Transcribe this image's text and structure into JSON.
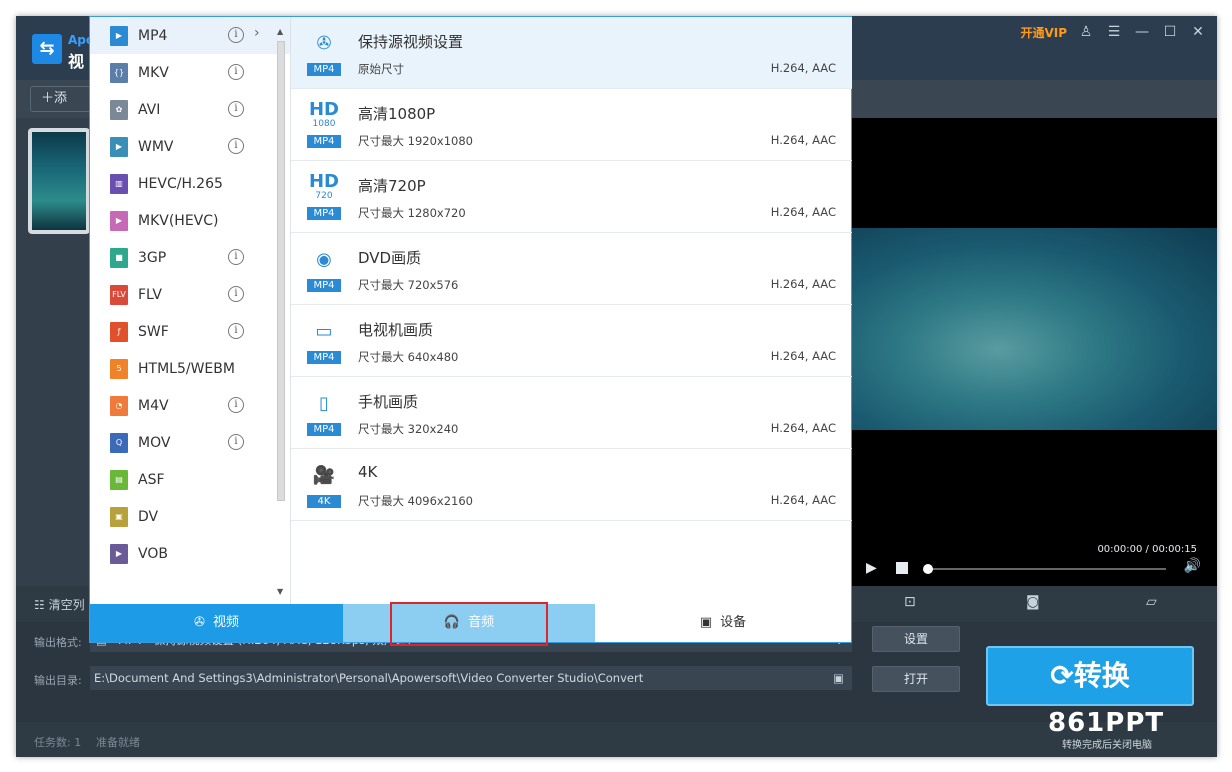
{
  "app": {
    "title_line1": "Apo",
    "title_line2": "视",
    "vip_label": "开通VIP",
    "add_button": "＋添"
  },
  "formats": [
    {
      "label": "MP4",
      "icon": "mp4-file-icon",
      "color": "#2a8ad4",
      "glyph": "▶",
      "info": true,
      "selected": true
    },
    {
      "label": "MKV",
      "icon": "mkv-file-icon",
      "color": "#5b7fa8",
      "glyph": "{}",
      "info": true
    },
    {
      "label": "AVI",
      "icon": "avi-file-icon",
      "color": "#7a8898",
      "glyph": "✿",
      "info": true
    },
    {
      "label": "WMV",
      "icon": "wmv-file-icon",
      "color": "#3a8fb8",
      "glyph": "▶",
      "info": true
    },
    {
      "label": "HEVC/H.265",
      "icon": "hevc-file-icon",
      "color": "#6a4fb0",
      "glyph": "▥",
      "info": false
    },
    {
      "label": "MKV(HEVC)",
      "icon": "mkv-hevc-file-icon",
      "color": "#c66ab8",
      "glyph": "▶",
      "info": false
    },
    {
      "label": "3GP",
      "icon": "3gp-file-icon",
      "color": "#2ea88c",
      "glyph": "■",
      "info": true
    },
    {
      "label": "FLV",
      "icon": "flv-file-icon",
      "color": "#d94a3a",
      "glyph": "FLV",
      "info": true
    },
    {
      "label": "SWF",
      "icon": "swf-file-icon",
      "color": "#e0502a",
      "glyph": "ƒ",
      "info": true
    },
    {
      "label": "HTML5/WEBM",
      "icon": "html5-file-icon",
      "color": "#f0822a",
      "glyph": "5",
      "info": false
    },
    {
      "label": "M4V",
      "icon": "m4v-file-icon",
      "color": "#f07a3a",
      "glyph": "◔",
      "info": true
    },
    {
      "label": "MOV",
      "icon": "mov-file-icon",
      "color": "#3a6ab8",
      "glyph": "Q",
      "info": true
    },
    {
      "label": "ASF",
      "icon": "asf-file-icon",
      "color": "#6ab83a",
      "glyph": "▤",
      "info": false
    },
    {
      "label": "DV",
      "icon": "dv-file-icon",
      "color": "#b8a03a",
      "glyph": "▣",
      "info": false
    },
    {
      "label": "VOB",
      "icon": "vob-file-icon",
      "color": "#6a5a98",
      "glyph": "▶",
      "info": false
    }
  ],
  "presets": [
    {
      "title": "保持源视频设置",
      "desc": "原始尺寸",
      "codec": "H.264, AAC",
      "glyph": "✇",
      "sub": "",
      "badge": "MP4",
      "icon": "film-reel-icon",
      "selected": true
    },
    {
      "title": "高清1080P",
      "desc": "尺寸最大 1920x1080",
      "codec": "H.264, AAC",
      "glyph": "HD",
      "sub": "1080",
      "badge": "MP4",
      "icon": "hd-1080-icon"
    },
    {
      "title": "高清720P",
      "desc": "尺寸最大 1280x720",
      "codec": "H.264, AAC",
      "glyph": "HD",
      "sub": "720",
      "badge": "MP4",
      "icon": "hd-720-icon"
    },
    {
      "title": "DVD画质",
      "desc": "尺寸最大 720x576",
      "codec": "H.264, AAC",
      "glyph": "◉",
      "sub": "",
      "badge": "MP4",
      "icon": "dvd-disc-icon"
    },
    {
      "title": "电视机画质",
      "desc": "尺寸最大 640x480",
      "codec": "H.264, AAC",
      "glyph": "▭",
      "sub": "",
      "badge": "MP4",
      "icon": "tv-icon"
    },
    {
      "title": "手机画质",
      "desc": "尺寸最大 320x240",
      "codec": "H.264, AAC",
      "glyph": "▯",
      "sub": "",
      "badge": "MP4",
      "icon": "phone-icon"
    },
    {
      "title": "4K",
      "desc": "尺寸最大 4096x2160",
      "codec": "H.264, AAC",
      "glyph": "🎥",
      "sub": "",
      "badge": "4K",
      "icon": "camera-4k-icon"
    }
  ],
  "tabs": {
    "video": "视频",
    "audio": "音频",
    "device": "设备"
  },
  "list": {
    "clear_button": "清空列"
  },
  "preview": {
    "time": "00:00:00 / 00:00:15",
    "progress": 0
  },
  "output": {
    "format_label": "输出格式:",
    "format_value": "MP4 - 保持源视频设置 (H.264; AAC, 128Kbps, 双声道)",
    "dir_label": "输出目录:",
    "dir_value": "E:\\Document And Settings3\\Administrator\\Personal\\Apowersoft\\Video Converter Studio\\Convert",
    "settings_button": "设置",
    "open_button": "打开",
    "convert_button": "转换"
  },
  "status": {
    "task_count": "任务数: 1",
    "ready": "准备就绪"
  },
  "watermark": {
    "brand": "861PPT",
    "sub": "转换完成后关闭电脑"
  },
  "colors": {
    "accent": "#1e9be6",
    "vip": "#ff9a1a",
    "highlight": "#e0242a"
  }
}
